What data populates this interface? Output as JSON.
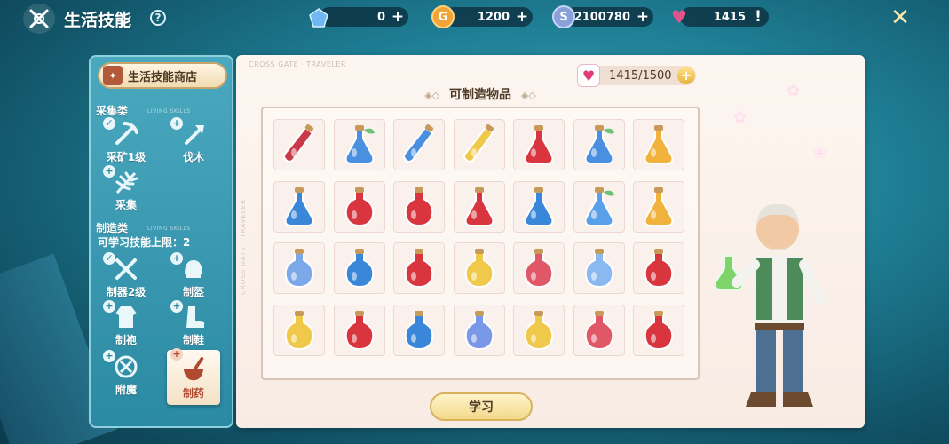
{
  "header": {
    "title": "生活技能",
    "help_glyph": "?",
    "close_glyph": "✕",
    "currencies": [
      {
        "name": "crystal",
        "icon": "crystal-icon",
        "value": "0",
        "color": "#6fb8f2"
      },
      {
        "name": "gold",
        "icon": "gold-coin-icon",
        "value": "1200",
        "color": "#f0a43a"
      },
      {
        "name": "silver",
        "icon": "silver-coin-icon",
        "value": "2100780",
        "color": "#8aa0d8"
      },
      {
        "name": "energy",
        "icon": "heart-icon",
        "value": "1415",
        "color": "#e4538b"
      }
    ],
    "energy_alert": "!"
  },
  "sidebar": {
    "shop_label": "生活技能商店",
    "gathering": {
      "title": "采集类",
      "subtitle": "LIVING SKILLS",
      "skills": [
        {
          "label": "采矿1级",
          "icon": "pickaxe-icon",
          "badge": "✓"
        },
        {
          "label": "伐木",
          "icon": "axe-icon",
          "badge": "+"
        },
        {
          "label": "采集",
          "icon": "leaf-icon",
          "badge": "+"
        }
      ]
    },
    "crafting": {
      "title": "制造类",
      "subtitle": "LIVING SKILLS",
      "learn_limit": "可学习技能上限：2",
      "skills": [
        {
          "label": "制器2级",
          "icon": "weapon-craft-icon",
          "badge": "✓"
        },
        {
          "label": "制盔",
          "icon": "helmet-craft-icon",
          "badge": "+"
        },
        {
          "label": "制袍",
          "icon": "robe-craft-icon",
          "badge": "+"
        },
        {
          "label": "制鞋",
          "icon": "boot-craft-icon",
          "badge": "+"
        },
        {
          "label": "附魔",
          "icon": "enchant-icon",
          "badge": "+"
        },
        {
          "label": "制药",
          "icon": "mortar-pestle-icon",
          "badge": "+",
          "active": true
        }
      ]
    }
  },
  "main": {
    "watermark": "CROSS GATE · TRAVELER",
    "side_watermark": "CROSS GATE · TRAVELER",
    "energy": "1415/1500",
    "energy_plus": "+",
    "craftable_title": "可制造物品",
    "title_deco": "◈◇",
    "learn_button": "学习",
    "potions": [
      {
        "shape": "vial",
        "color": "#c83a4a"
      },
      {
        "shape": "leaf-flask",
        "color": "#4a8fe0"
      },
      {
        "shape": "vial",
        "color": "#4a8fe0"
      },
      {
        "shape": "vial",
        "color": "#f0c94a"
      },
      {
        "shape": "flask",
        "color": "#d8353f"
      },
      {
        "shape": "leaf-flask",
        "color": "#4a8fe0"
      },
      {
        "shape": "flask",
        "color": "#f0b23a"
      },
      {
        "shape": "flask",
        "color": "#3a86d8"
      },
      {
        "shape": "round",
        "color": "#d8353f"
      },
      {
        "shape": "round",
        "color": "#d8353f"
      },
      {
        "shape": "flask",
        "color": "#d8353f"
      },
      {
        "shape": "flask",
        "color": "#3a86d8"
      },
      {
        "shape": "leaf-flask",
        "color": "#5aa0e8"
      },
      {
        "shape": "flask",
        "color": "#f0b23a"
      },
      {
        "shape": "round",
        "color": "#7aa8e8"
      },
      {
        "shape": "round",
        "color": "#3a86d8"
      },
      {
        "shape": "round",
        "color": "#d8353f"
      },
      {
        "shape": "round",
        "color": "#f0c94a"
      },
      {
        "shape": "round",
        "color": "#e05868"
      },
      {
        "shape": "round",
        "color": "#8ab8f0"
      },
      {
        "shape": "round",
        "color": "#d8353f"
      },
      {
        "shape": "round",
        "color": "#f0c94a"
      },
      {
        "shape": "round",
        "color": "#d8353f"
      },
      {
        "shape": "round",
        "color": "#3a86d8"
      },
      {
        "shape": "round",
        "color": "#7a98e8"
      },
      {
        "shape": "round",
        "color": "#f0c94a"
      },
      {
        "shape": "round",
        "color": "#e05868"
      },
      {
        "shape": "round",
        "color": "#d8353f"
      }
    ]
  },
  "npc": {
    "name": "herbalist-npc"
  }
}
